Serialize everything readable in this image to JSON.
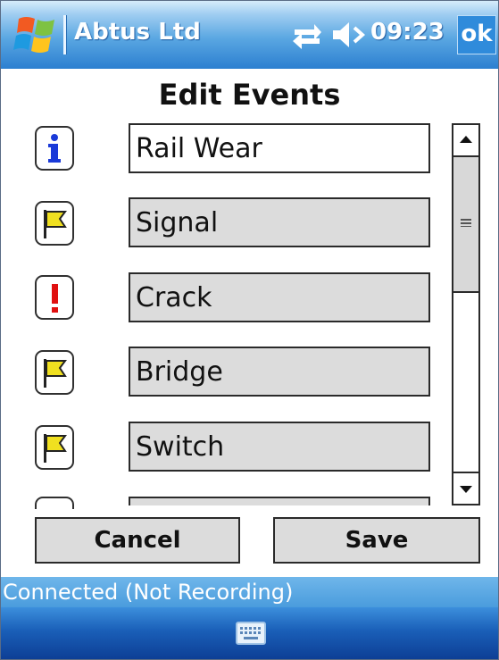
{
  "titlebar": {
    "app_title": "Abtus Ltd",
    "time": "09:23",
    "ok_label": "ok",
    "icons": [
      "windows-start-icon",
      "sync-arrows-icon",
      "speaker-volume-icon"
    ]
  },
  "page": {
    "heading": "Edit Events"
  },
  "events": [
    {
      "icon": "info-icon",
      "label": "Rail Wear",
      "active": true
    },
    {
      "icon": "flag-icon",
      "label": "Signal",
      "active": false
    },
    {
      "icon": "exclamation-icon",
      "label": "Crack",
      "active": false
    },
    {
      "icon": "flag-icon",
      "label": "Bridge",
      "active": false
    },
    {
      "icon": "flag-icon",
      "label": "Switch",
      "active": false
    }
  ],
  "buttons": {
    "cancel": "Cancel",
    "save": "Save"
  },
  "status": {
    "text": "Connected (Not Recording)"
  },
  "menubar": {
    "icons": [
      "keyboard-icon"
    ]
  },
  "colors": {
    "titlebar_blue": "#2c7fd0",
    "status_blue": "#5aa7e2",
    "info_blue": "#1a3ad8",
    "alert_red": "#e01010",
    "flag_yellow": "#f0e020"
  }
}
